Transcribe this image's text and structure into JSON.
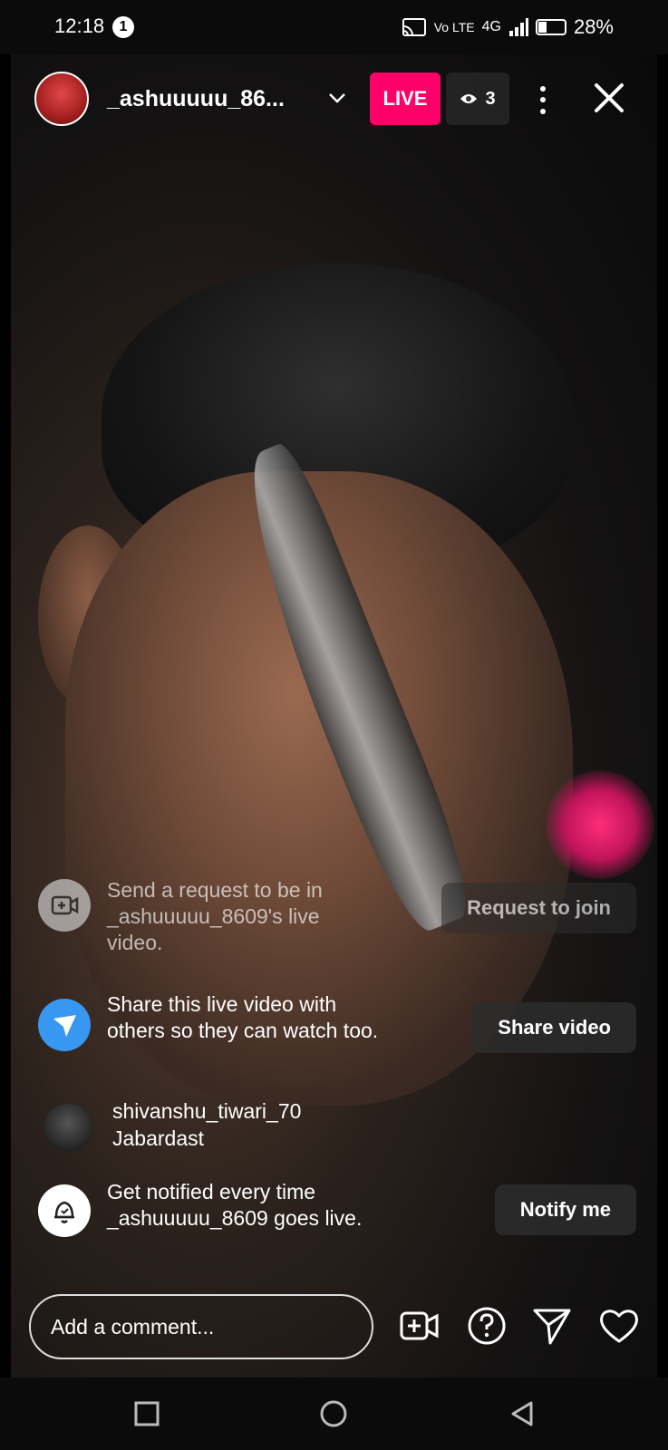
{
  "status_bar": {
    "time": "12:18",
    "notification_count": "1",
    "network_small": "Vo LTE",
    "network": "4G",
    "battery": "28%"
  },
  "header": {
    "username": "_ashuuuuu_86...",
    "live_label": "LIVE",
    "viewer_count": "3"
  },
  "feed": {
    "join": {
      "text": "Send a request to be in _ashuuuuu_8609's live video.",
      "button": "Request to join",
      "icon": "video-add-icon"
    },
    "share": {
      "text": "Share this live video with others so they can watch too.",
      "button": "Share video",
      "icon": "send-icon",
      "icon_color": "#3897f0"
    },
    "comment": {
      "user": "shivanshu_tiwari_70",
      "text": "Jabardast"
    },
    "notify": {
      "text": "Get notified every time _ashuuuuu_8609 goes live.",
      "button": "Notify me",
      "icon": "bell-icon"
    }
  },
  "footer": {
    "comment_placeholder": "Add a comment..."
  },
  "colors": {
    "live": "#ff0069",
    "share_icon": "#3897f0"
  }
}
